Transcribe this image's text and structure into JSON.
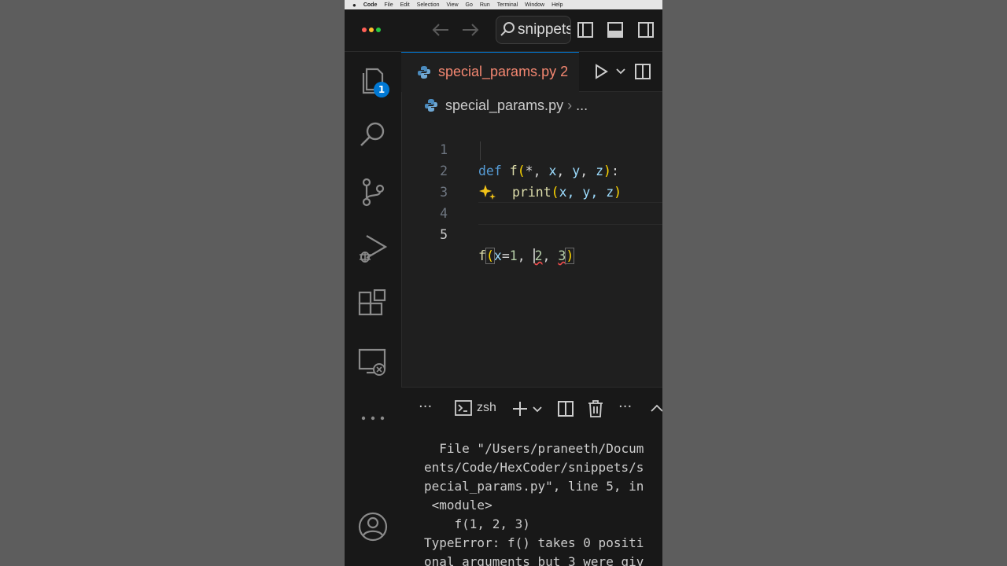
{
  "menubar": {
    "apple": "",
    "items": [
      "Code",
      "File",
      "Edit",
      "Selection",
      "View",
      "Go",
      "Run",
      "Terminal",
      "Window",
      "Help"
    ]
  },
  "titlebar": {
    "search_text": "snippets"
  },
  "activity": {
    "explorer_badge": "1"
  },
  "tab": {
    "filename": "special_params.py",
    "problems": "2"
  },
  "breadcrumb": {
    "file": "special_params.py",
    "more": "..."
  },
  "editor": {
    "line_numbers": [
      "1",
      "2",
      "3",
      "4",
      "5"
    ],
    "line1": {
      "kw": "def",
      "fn": "f",
      "open": "(",
      "star": "*",
      "c1": ", ",
      "x": "x",
      "c2": ", ",
      "y": "y",
      "c3": ", ",
      "z": "z",
      "close": ")",
      "colon": ":"
    },
    "line2": {
      "fn": "print",
      "open": "(",
      "args": "x, y, z",
      "close": ")"
    },
    "line5": {
      "fn": "f",
      "open": "(",
      "kw": "x",
      "eq": "=",
      "v1": "1",
      "c1": ", ",
      "v2": "2",
      "c2": ", ",
      "v3": "3",
      "close": ")"
    }
  },
  "panel": {
    "shell": "zsh",
    "more": "···",
    "output": [
      "  File \"/Users/praneeth/Docum",
      "ents/Code/HexCoder/snippets/s",
      "pecial_params.py\", line 5, in",
      " <module>",
      "    f(1, 2, 3)",
      "TypeError: f() takes 0 positi",
      "onal arguments but 3 were giv"
    ]
  },
  "colors": {
    "accent": "#0078d4",
    "tab_error": "#f48771",
    "keyword": "#569cd6",
    "function": "#dcdcaa",
    "bracket": "#ffd700"
  }
}
